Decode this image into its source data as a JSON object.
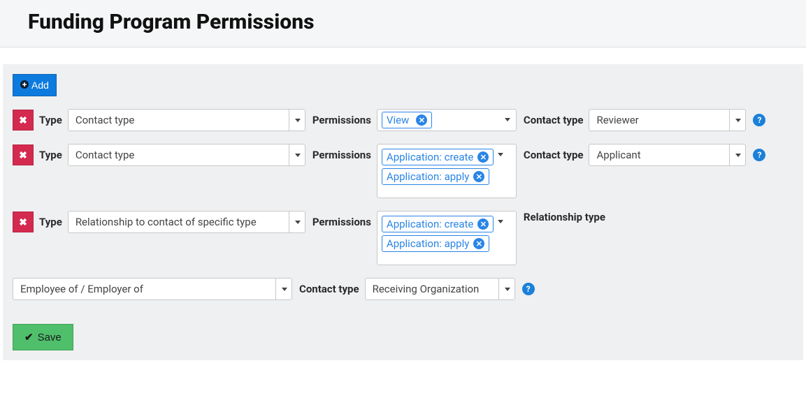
{
  "page": {
    "title": "Funding Program Permissions"
  },
  "buttons": {
    "add": "Add",
    "save": "Save"
  },
  "labels": {
    "type": "Type",
    "permissions": "Permissions",
    "contact_type": "Contact type",
    "relationship_type": "Relationship type"
  },
  "rows": [
    {
      "type_value": "Contact type",
      "permissions": [
        "View"
      ],
      "secondary_label": "Contact type",
      "secondary_value": "Reviewer"
    },
    {
      "type_value": "Contact type",
      "permissions": [
        "Application: create",
        "Application: apply"
      ],
      "secondary_label": "Contact type",
      "secondary_value": "Applicant"
    },
    {
      "type_value": "Relationship to contact of specific type",
      "permissions": [
        "Application: create",
        "Application: apply"
      ],
      "secondary_label": "Relationship type",
      "relationship_value": "Employee of / Employer of",
      "related_contact_type": "Receiving Organization"
    }
  ]
}
